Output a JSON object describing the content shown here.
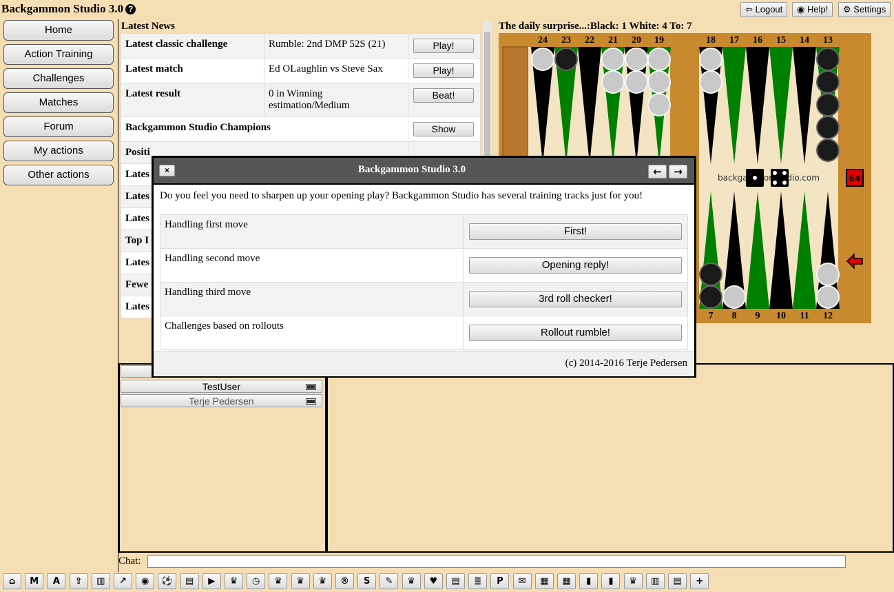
{
  "app": {
    "title": "Backgammon Studio 3.0",
    "help_icon": "question-circle-icon"
  },
  "topbar": {
    "logout": "Logout",
    "help": "Help!",
    "settings": "Settings"
  },
  "nav": [
    "Home",
    "Action Training",
    "Challenges",
    "Matches",
    "Forum",
    "My actions",
    "Other actions"
  ],
  "news": {
    "title": "Latest News",
    "rows": [
      {
        "key": "Latest classic challenge",
        "value": "Rumble: 2nd DMP 52S (21)",
        "button": "Play!"
      },
      {
        "key": "Latest match",
        "value": "Ed OLaughlin vs Steve Sax",
        "button": "Play!"
      },
      {
        "key": "Latest result",
        "value": "0 in Winning estimation/Medium",
        "button": "Beat!"
      },
      {
        "key": "Backgammon Studio Champions",
        "value": "",
        "button": "Show"
      },
      {
        "key": "Positi",
        "value": "",
        "button": ""
      },
      {
        "key": "Lates",
        "value": "",
        "button": ""
      },
      {
        "key": "Lates",
        "value": "",
        "button": ""
      },
      {
        "key": "Lates",
        "value": "",
        "button": ""
      },
      {
        "key": "Top I",
        "value": "",
        "button": ""
      },
      {
        "key": "Lates",
        "value": "",
        "button": ""
      },
      {
        "key": "Fewe",
        "value": "",
        "button": ""
      },
      {
        "key": "Lates",
        "value": "",
        "button": ""
      }
    ]
  },
  "surprise": {
    "title": "The daily surprise...:Black: 1 White: 4 To: 7",
    "top_points": [
      "24",
      "23",
      "22",
      "21",
      "20",
      "19",
      "18",
      "17",
      "16",
      "15",
      "14",
      "13"
    ],
    "bottom_points": [
      "7",
      "8",
      "9",
      "10",
      "11",
      "12"
    ],
    "watermark": "backgammonstudio.com",
    "cube": "64",
    "colors": {
      "dark_triangle": "#000000",
      "green_triangle": "#008000",
      "wood": "#c8892f",
      "cube": "#e00000"
    }
  },
  "users": [
    {
      "name": "TestUser",
      "status": "battery-icon"
    },
    {
      "name": "Terje Pedersen",
      "status": "battery-icon"
    }
  ],
  "chat": {
    "label": "Chat:",
    "value": ""
  },
  "toolbar": [
    {
      "name": "home-icon",
      "glyph": "⌂"
    },
    {
      "name": "m-icon",
      "glyph": "M"
    },
    {
      "name": "a-icon",
      "glyph": "A"
    },
    {
      "name": "upload-icon",
      "glyph": "⇪"
    },
    {
      "name": "bar-chart-icon",
      "glyph": "▥"
    },
    {
      "name": "line-chart-icon",
      "glyph": "↗"
    },
    {
      "name": "eye-icon",
      "glyph": "◉"
    },
    {
      "name": "soccer-ball-icon",
      "glyph": "⚽"
    },
    {
      "name": "archive-icon",
      "glyph": "▤"
    },
    {
      "name": "play-icon",
      "glyph": "▶"
    },
    {
      "name": "trophy-icon",
      "glyph": "♛"
    },
    {
      "name": "clock-icon",
      "glyph": "◷"
    },
    {
      "name": "trophy-icon-2",
      "glyph": "♛"
    },
    {
      "name": "trophy-icon-3",
      "glyph": "♛"
    },
    {
      "name": "trophy-icon-4",
      "glyph": "♛"
    },
    {
      "name": "registered-icon",
      "glyph": "®"
    },
    {
      "name": "s-icon",
      "glyph": "S"
    },
    {
      "name": "edit-icon",
      "glyph": "✎"
    },
    {
      "name": "trophy-icon-5",
      "glyph": "♛"
    },
    {
      "name": "heart-icon",
      "glyph": "♥"
    },
    {
      "name": "archive-icon-2",
      "glyph": "▤"
    },
    {
      "name": "database-icon",
      "glyph": "≣"
    },
    {
      "name": "p-icon",
      "glyph": "P"
    },
    {
      "name": "comments-icon",
      "glyph": "✉"
    },
    {
      "name": "film-icon",
      "glyph": "▦"
    },
    {
      "name": "table-icon",
      "glyph": "▦"
    },
    {
      "name": "bookmark-icon",
      "glyph": "▮"
    },
    {
      "name": "bookmark-icon-2",
      "glyph": "▮"
    },
    {
      "name": "trophy-icon-6",
      "glyph": "♛"
    },
    {
      "name": "bar-chart-icon-2",
      "glyph": "▥"
    },
    {
      "name": "archive-icon-3",
      "glyph": "▤"
    },
    {
      "name": "plus-icon",
      "glyph": "+"
    }
  ],
  "dialog": {
    "title": "Backgammon Studio 3.0",
    "close": "×",
    "prev": "←",
    "next": "→",
    "text": "Do you feel you need to sharpen up your opening play? Backgammon Studio has several training tracks just for you!",
    "rows": [
      {
        "label": "Handling first move",
        "button": "First!"
      },
      {
        "label": "Handling second move",
        "button": "Opening reply!"
      },
      {
        "label": "Handling third move",
        "button": "3rd roll checker!"
      },
      {
        "label": "Challenges based on rollouts",
        "button": "Rollout rumble!"
      }
    ],
    "footer": "(c) 2014-2016 Terje Pedersen"
  }
}
